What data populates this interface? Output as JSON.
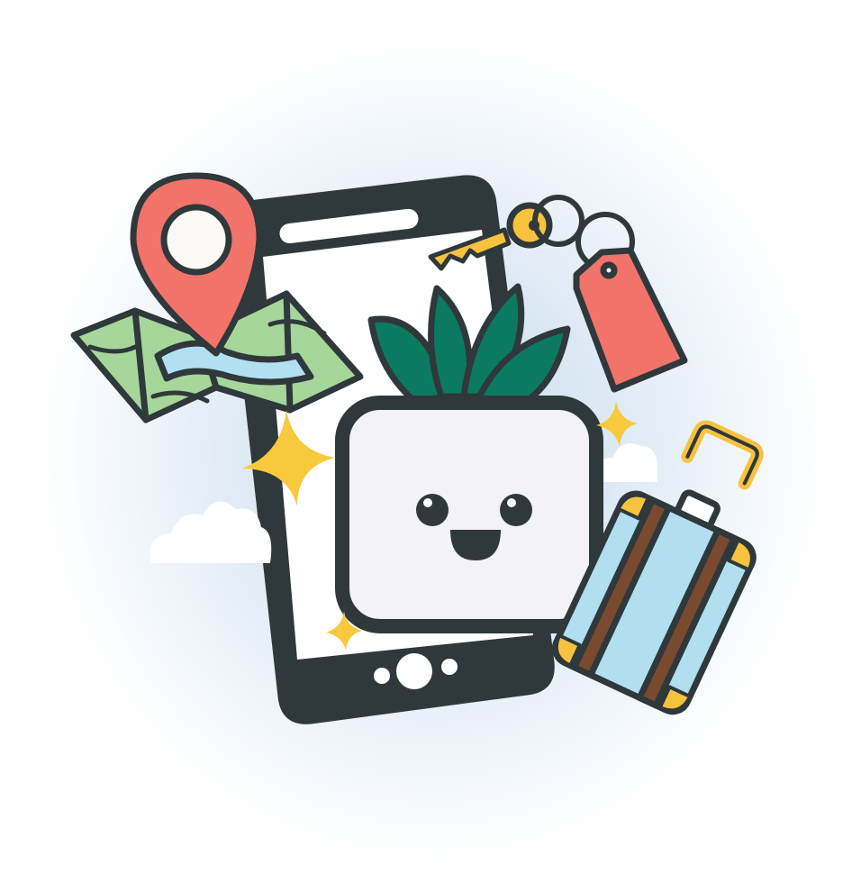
{
  "illustration": {
    "subject": "travel-app-phone",
    "colors": {
      "outline": "#2f383b",
      "pin_red": "#f2736a",
      "map_green": "#a6d69a",
      "water_blue": "#b2e0f2",
      "leaf_green": "#0b7a61",
      "pot": "#f3f2f8",
      "key_yellow": "#f7c23e",
      "suitcase_blue": "#b1dff0",
      "strap_brown": "#7a4a2e",
      "star_yellow": "#f9c93d"
    },
    "icons": [
      "phone-icon",
      "map-icon",
      "location-pin-icon",
      "key-icon",
      "tag-icon",
      "plant-pot-icon",
      "suitcase-icon",
      "star-icon",
      "cloud-icon"
    ]
  }
}
